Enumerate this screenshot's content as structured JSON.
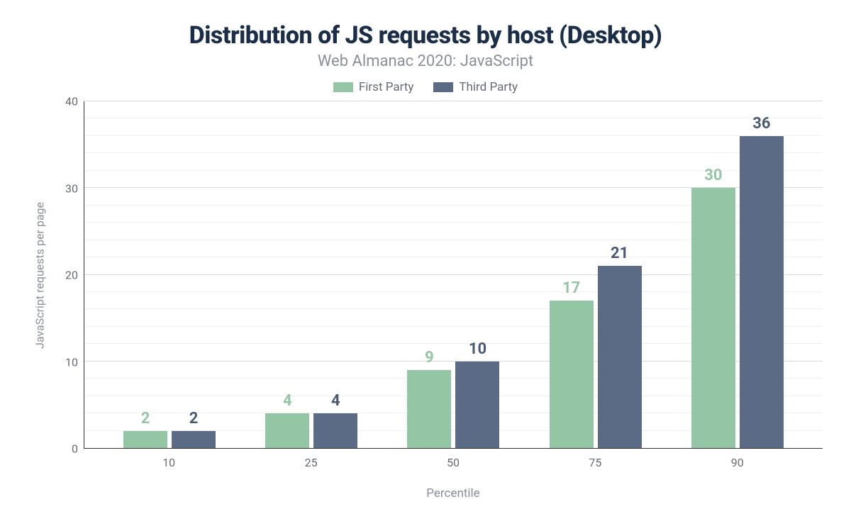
{
  "chart_data": {
    "type": "bar",
    "title": "Distribution of JS requests by host (Desktop)",
    "subtitle": "Web Almanac 2020: JavaScript",
    "xlabel": "Percentile",
    "ylabel": "JavaScript requests per page",
    "categories": [
      "10",
      "25",
      "50",
      "75",
      "90"
    ],
    "series": [
      {
        "name": "First Party",
        "color": "#94c5a5",
        "label_color": "#94c5a5",
        "values": [
          2,
          4,
          9,
          17,
          30
        ]
      },
      {
        "name": "Third Party",
        "color": "#5b6b85",
        "label_color": "#4a5a74",
        "values": [
          2,
          4,
          10,
          21,
          36
        ]
      }
    ],
    "ylim": [
      0,
      40
    ],
    "yticks": [
      0,
      10,
      20,
      30,
      40
    ],
    "minor_yticks": [
      2,
      4,
      6,
      8,
      12,
      14,
      16,
      18,
      22,
      24,
      26,
      28,
      32,
      34,
      36,
      38
    ]
  }
}
